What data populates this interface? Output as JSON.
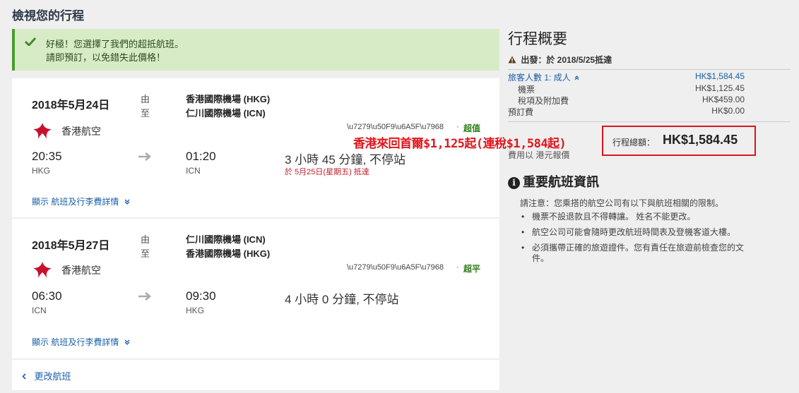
{
  "page_title": "檢視您的行程",
  "banner": {
    "line1": "好極！您選擇了我們的超抵航班。",
    "line2": "請即預訂，以免錯失此價格！"
  },
  "flights": [
    {
      "date": "2018年5月24日",
      "from_label": "由",
      "to_label": "至",
      "from_airport": "香港國際機場 (HKG)",
      "to_airport": "仁川國際機場 (ICN)",
      "airline": "香港航空",
      "flight_code": "\\u7279\\u50F9\\u6A5F\\u7968",
      "dot": "·",
      "deal": "超值",
      "dep_time": "20:35",
      "dep_iata": "HKG",
      "arr_time": "01:20",
      "arr_iata": "ICN",
      "duration": "3 小時 45 分鐘, 不停站",
      "arrival_note": "於 5月25日(星期五) 抵達",
      "details_link": "顯示 航班及行李費詳情"
    },
    {
      "date": "2018年5月27日",
      "from_label": "由",
      "to_label": "至",
      "from_airport": "仁川國際機場 (ICN)",
      "to_airport": "香港國際機場 (HKG)",
      "airline": "香港航空",
      "flight_code": "\\u7279\\u50F9\\u6A5F\\u7968",
      "dot": "·",
      "deal": "超平",
      "dep_time": "06:30",
      "dep_iata": "ICN",
      "arr_time": "09:30",
      "arr_iata": "HKG",
      "duration": "4 小時 0 分鐘, 不停站",
      "arrival_note": "",
      "details_link": "顯示 航班及行李費詳情"
    }
  ],
  "change_flight": "更改航班",
  "summary": {
    "title": "行程概要",
    "departure": "出發：於 2018/5/25抵達",
    "travelers_label": "旅客人數 1: 成人",
    "travelers_amount": "HK$1,584.45",
    "ticket_label": "機票",
    "ticket_amount": "HK$1,125.45",
    "tax_label": "稅項及附加費",
    "tax_amount": "HK$459.00",
    "booking_fee_label": "預訂費",
    "booking_fee_amount": "HK$0.00",
    "total_label": "行程總額：",
    "total_amount": "HK$1,584.45",
    "currency_note": "費用以 港元報價"
  },
  "promo": "香港來回首爾$1,125起(連稅$1,584起)",
  "info": {
    "title": "重要航班資訊",
    "icon_glyph": "i",
    "notice": "請注意：您乘搭的航空公司有以下與航班相關的限制。",
    "bullets": [
      "機票不設退款且不得轉讓。 姓名不能更改。",
      "航空公司可能會隨時更改航班時間表及登機客道大樓。",
      "必須攜帶正確的旅遊證件。您有責任在旅遊前檢查您的文件。"
    ]
  },
  "colors": {
    "accent_link": "#1a5fa8",
    "success_bg": "#d7ecc6",
    "promo_red": "#e0161d",
    "deal_green": "#2d7d1a"
  }
}
